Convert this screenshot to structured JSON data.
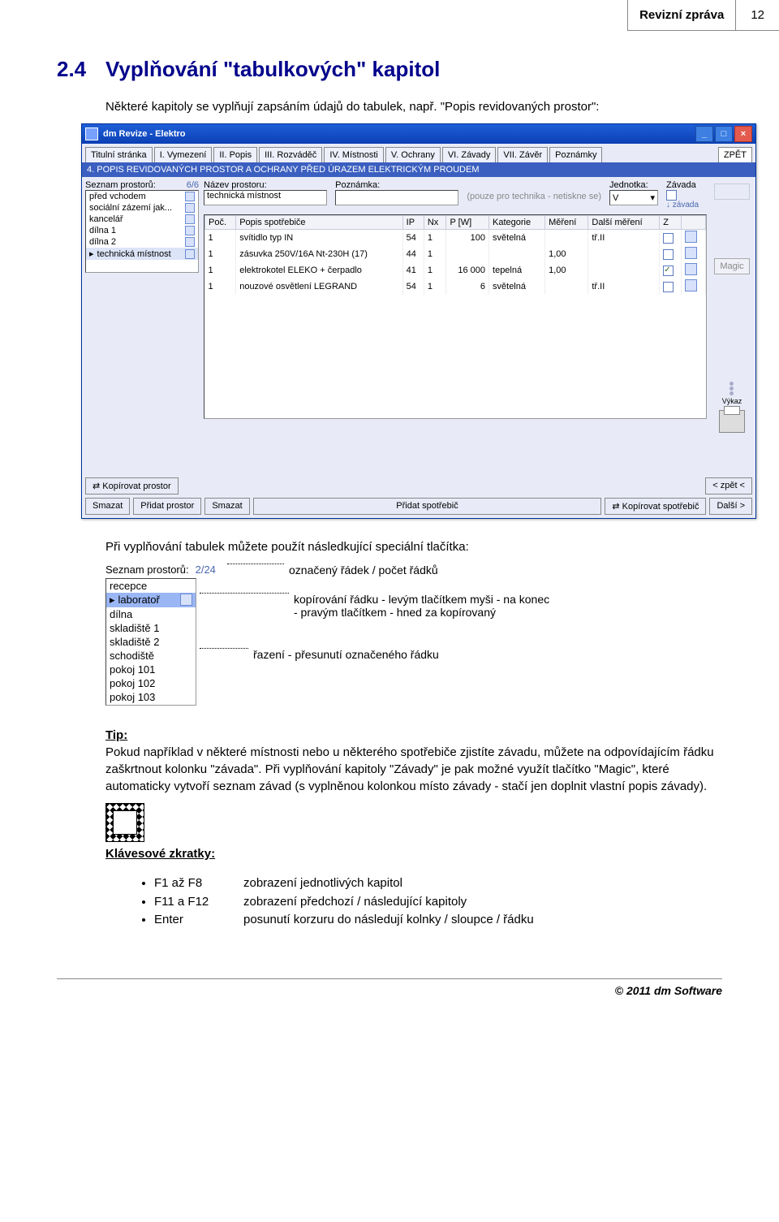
{
  "header": {
    "title": "Revizní zpráva",
    "page": "12"
  },
  "section": {
    "number": "2.4",
    "title": "Vyplňování \"tabulkových\" kapitol"
  },
  "intro": "Některé kapitoly se vyplňují zapsáním údajů do tabulek, např. \"Popis revidovaných prostor\":",
  "app": {
    "title": "dm Revize - Elektro",
    "tabs": [
      "Titulní stránka",
      "I. Vymezení",
      "II. Popis",
      "III. Rozváděč",
      "IV. Místnosti",
      "V. Ochrany",
      "VI. Závady",
      "VII. Závěr",
      "Poznámky"
    ],
    "tab_right": "ZPĚT",
    "section_bar": "4. POPIS REVIDOVANÝCH PROSTOR A OCHRANY PŘED ÚRAZEM ELEKTRICKÝM PROUDEM",
    "left": {
      "label": "Seznam prostorů:",
      "counter": "6/6",
      "items": [
        "před vchodem",
        "sociální zázemí jak...",
        "kancelář",
        "dílna 1",
        "dílna 2",
        "technická místnost"
      ]
    },
    "fields": {
      "nazev_label": "Název prostoru:",
      "nazev_val": "technická místnost",
      "poznamka_label": "Poznámka:",
      "poznamka_hint": "(pouze pro technika - netiskne se)",
      "jednotka_label": "Jednotka:",
      "jednotka_val": "V",
      "zavada_label": "Závada",
      "zavada_link": "↓ závada"
    },
    "table": {
      "headers": [
        "Poč.",
        "Popis spotřebiče",
        "IP",
        "Nx",
        "P [W]",
        "Kategorie",
        "Měření",
        "Další měření",
        "Z"
      ],
      "rows": [
        {
          "poc": "1",
          "popis": "svítidlo typ IN",
          "ip": "54",
          "nx": "1",
          "pw": "100",
          "kat": "světelná",
          "mer": "",
          "dm": "tř.II",
          "z": false,
          "z2": false
        },
        {
          "poc": "1",
          "popis": "zásuvka 250V/16A Nt-230H (17)",
          "ip": "44",
          "nx": "1",
          "pw": "",
          "kat": "",
          "mer": "1,00",
          "dm": "",
          "z": false,
          "z2": false
        },
        {
          "poc": "1",
          "popis": "elektrokotel ELEKO + čerpadlo",
          "ip": "41",
          "nx": "1",
          "pw": "16 000",
          "kat": "tepelná",
          "mer": "1,00",
          "dm": "",
          "z": true,
          "z2": false
        },
        {
          "poc": "1",
          "popis": "nouzové osvětlení LEGRAND",
          "ip": "54",
          "nx": "1",
          "pw": "6",
          "kat": "světelná",
          "mer": "",
          "dm": "tř.II",
          "z": false,
          "z2": false
        }
      ]
    },
    "side": {
      "magic": "Magic",
      "vykaz": "Výkaz"
    },
    "bottom": {
      "copy_room": "⇄ Kopírovat prostor",
      "del": "Smazat",
      "add_room": "Přidat prostor",
      "del2": "Smazat",
      "add_app": "Přidat spotřebič",
      "copy_app": "⇄ Kopírovat spotřebič",
      "back": "< zpět <",
      "next": "Další >"
    }
  },
  "para2": "Při vyplňování tabulek můžete použít následkující speciální tlačítka:",
  "annot": {
    "label": "Seznam prostorů:",
    "counter": "2/24",
    "a1": "označený řádek / počet řádků",
    "a2a": "kopírování řádku - levým tlačítkem myši - na konec",
    "a2b": "- pravým tlačítkem - hned za kopírovaný",
    "a3": "řazení - přesunutí označeného řádku",
    "items": [
      "recepce",
      "laboratoř",
      "dílna",
      "skladiště 1",
      "skladiště 2",
      "schodiště",
      "pokoj 101",
      "pokoj 102",
      "pokoj 103"
    ]
  },
  "tip_label": "Tip:",
  "tip_text": "Pokud například v některé místnosti nebo u některého spotřebiče zjistíte závadu, můžete na odpovídajícím řádku zaškrtnout kolonku \"závada\". Při vyplňování kapitoly \"Závady\" je pak možné využít tlačítko \"Magic\", které automaticky vytvoří seznam závad (s vyplněnou kolonkou místo závady - stačí jen doplnit vlastní popis závady).",
  "shortcuts": {
    "title": "Klávesové zkratky:",
    "rows": [
      {
        "k": "F1 až F8",
        "d": "zobrazení jednotlivých kapitol"
      },
      {
        "k": "F11 a F12",
        "d": "zobrazení předchozí / následující kapitoly"
      },
      {
        "k": "Enter",
        "d": "posunutí korzuru do následují kolnky / sloupce / řádku"
      }
    ]
  },
  "footer": "© 2011 dm Software"
}
